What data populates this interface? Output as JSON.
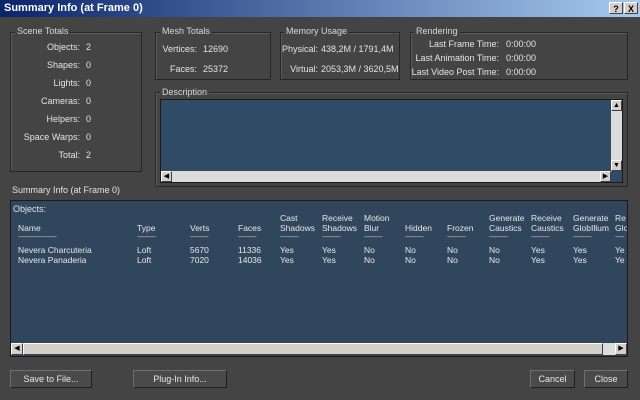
{
  "window": {
    "title": "Summary Info (at Frame 0)",
    "help_btn": "?",
    "close_btn": "X"
  },
  "scene": {
    "label": "Scene Totals",
    "rows": [
      {
        "label": "Objects:",
        "value": "2"
      },
      {
        "label": "Shapes:",
        "value": "0"
      },
      {
        "label": "Lights:",
        "value": "0"
      },
      {
        "label": "Cameras:",
        "value": "0"
      },
      {
        "label": "Helpers:",
        "value": "0"
      },
      {
        "label": "Space Warps:",
        "value": "0"
      },
      {
        "label": "Total:",
        "value": "2"
      }
    ]
  },
  "mesh": {
    "label": "Mesh Totals",
    "rows": [
      {
        "label": "Vertices:",
        "value": "12690"
      },
      {
        "label": "Faces:",
        "value": "25372"
      }
    ]
  },
  "memory": {
    "label": "Memory Usage",
    "rows": [
      {
        "label": "Physical:",
        "value": "438,2M / 1791,4M"
      },
      {
        "label": "Virtual:",
        "value": "2053,3M / 3620,5M"
      }
    ]
  },
  "rendering": {
    "label": "Rendering",
    "rows": [
      {
        "label": "Last Frame Time:",
        "value": "0:00:00"
      },
      {
        "label": "Last Animation Time:",
        "value": "0:00:00"
      },
      {
        "label": "Last Video Post Time:",
        "value": "0:00:00"
      }
    ]
  },
  "description": {
    "label": "Description",
    "text": ""
  },
  "summary_label": "Summary Info (at Frame 0)",
  "objects": {
    "label": "Objects:",
    "columns": [
      {
        "l1": "",
        "l2": "Name",
        "dash": "---------------------"
      },
      {
        "l1": "",
        "l2": "Type",
        "dash": "----------"
      },
      {
        "l1": "",
        "l2": "Verts",
        "dash": "----------"
      },
      {
        "l1": "",
        "l2": "Faces",
        "dash": "----------"
      },
      {
        "l1": "Cast",
        "l2": "Shadows",
        "dash": "----------"
      },
      {
        "l1": "Receive",
        "l2": "Shadows",
        "dash": "----------"
      },
      {
        "l1": "Motion",
        "l2": "Blur",
        "dash": "----------"
      },
      {
        "l1": "",
        "l2": "Hidden",
        "dash": "----------"
      },
      {
        "l1": "",
        "l2": "Frozen",
        "dash": "----------"
      },
      {
        "l1": "Generate",
        "l2": "Caustics",
        "dash": "----------"
      },
      {
        "l1": "Receive",
        "l2": "Caustics",
        "dash": "----------"
      },
      {
        "l1": "Generate",
        "l2": "GlobIllum",
        "dash": "----------"
      },
      {
        "l1": "Re",
        "l2": "Glo",
        "dash": "-----"
      }
    ],
    "rows": [
      [
        "Nevera Charcuteria",
        "Loft",
        "5670",
        "11336",
        "Yes",
        "Yes",
        "No",
        "No",
        "No",
        "No",
        "Yes",
        "Yes",
        "Ye"
      ],
      [
        "Nevera Panaderia",
        "Loft",
        "7020",
        "14036",
        "Yes",
        "Yes",
        "No",
        "No",
        "No",
        "No",
        "Yes",
        "Yes",
        "Ye"
      ]
    ]
  },
  "buttons": {
    "save": "Save to File...",
    "plugin": "Plug-In Info...",
    "cancel": "Cancel",
    "close": "Close"
  }
}
